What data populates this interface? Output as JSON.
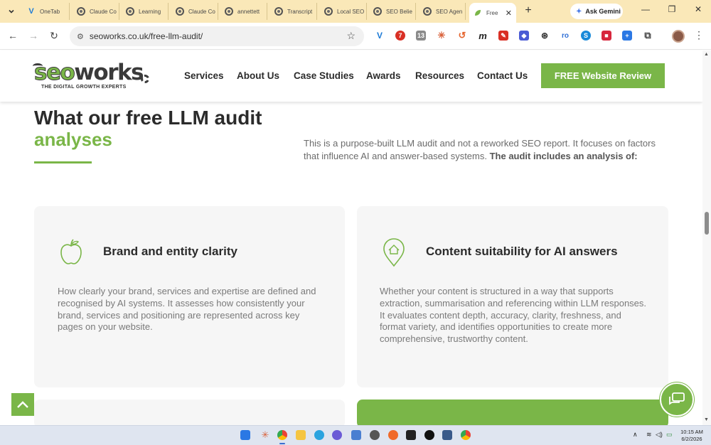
{
  "browser": {
    "tabs": [
      {
        "label": "OneTab",
        "icon": "v-icon"
      },
      {
        "label": "Claude Co",
        "icon": "globe-icon"
      },
      {
        "label": "Learning",
        "icon": "globe-icon"
      },
      {
        "label": "Claude Co",
        "icon": "globe-icon"
      },
      {
        "label": "annettett",
        "icon": "globe-icon"
      },
      {
        "label": "Transcript",
        "icon": "globe-icon"
      },
      {
        "label": "Local SEO",
        "icon": "globe-icon"
      },
      {
        "label": "SEO Belie",
        "icon": "globe-icon"
      },
      {
        "label": "SEO Agen",
        "icon": "globe-icon"
      }
    ],
    "active_tab": {
      "label": "Free",
      "icon": "seoworks-leaf-icon"
    },
    "ask_gemini_label": "Ask Gemini",
    "url": "seoworks.co.uk/free-llm-audit/",
    "extension_badges": {
      "first": "7",
      "second": "13"
    }
  },
  "site": {
    "logo": {
      "seo": "seo",
      "works": "works",
      "tagline": "THE DIGITAL GROWTH EXPERTS"
    },
    "nav": [
      "Services",
      "About Us",
      "Case Studies",
      "Awards",
      "Resources",
      "Contact Us"
    ],
    "cta": "FREE Website Review"
  },
  "section": {
    "title": "What our free LLM audit",
    "title_accent": "analyses",
    "intro_text": "This is a purpose-built LLM audit and not a reworked SEO report. It focuses on factors that influence AI and answer-based systems. ",
    "intro_bold": "The audit includes an analysis of:"
  },
  "cards": [
    {
      "icon": "apple-icon",
      "title": "Brand and entity clarity",
      "text": "How clearly your brand, services and expertise are defined and recognised by AI systems. It assesses how consistently your brand, services and positioning are represented across key pages on your website."
    },
    {
      "icon": "location-home-icon",
      "title": "Content suitability for AI answers",
      "text": "Whether your content is structured in a way that supports extraction, summarisation and referencing within LLM responses. It evaluates content depth, accuracy, clarity, freshness, and format variety, and identifies opportunities to create more comprehensive, trustworthy content."
    }
  ],
  "taskbar": {
    "time": "10:15 AM",
    "date": "6/2/2026"
  },
  "colors": {
    "brand_green": "#7ab648",
    "dark_text": "#2b2b2b",
    "tab_strip": "#fae8b8",
    "taskbar": "#dfe5f0"
  }
}
